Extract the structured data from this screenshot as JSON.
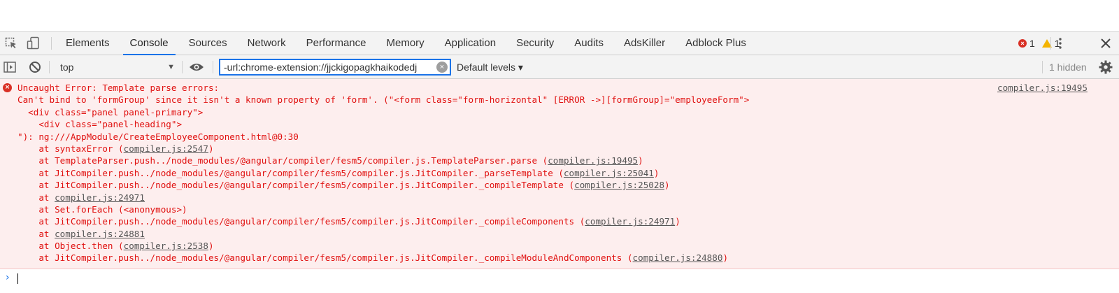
{
  "tabbar": {
    "tabs": [
      {
        "label": "Elements"
      },
      {
        "label": "Console"
      },
      {
        "label": "Sources"
      },
      {
        "label": "Network"
      },
      {
        "label": "Performance"
      },
      {
        "label": "Memory"
      },
      {
        "label": "Application"
      },
      {
        "label": "Security"
      },
      {
        "label": "Audits"
      },
      {
        "label": "AdsKiller"
      },
      {
        "label": "Adblock Plus"
      }
    ],
    "active_tab": "Console",
    "error_count": "1",
    "warning_count": "1"
  },
  "toolbar": {
    "context": "top",
    "filter_value": "-url:chrome-extension://jjckigopagkhaikodedj",
    "levels_label": "Default levels ▾",
    "hidden_label": "1 hidden"
  },
  "console": {
    "source_link": "compiler.js:19495",
    "lines": [
      {
        "text": "Uncaught Error: Template parse errors:"
      },
      {
        "text": "Can't bind to 'formGroup' since it isn't a known property of 'form'. (\"<form class=\"form-horizontal\" [ERROR ->][formGroup]=\"employeeForm\">"
      },
      {
        "text": "  <div class=\"panel panel-primary\">"
      },
      {
        "text": "    <div class=\"panel-heading\">"
      },
      {
        "text": "\"): ng:///AppModule/CreateEmployeeComponent.html@0:30"
      },
      {
        "text": "    at syntaxError (",
        "link": "compiler.js:2547",
        "suffix": ")"
      },
      {
        "text": "    at TemplateParser.push../node_modules/@angular/compiler/fesm5/compiler.js.TemplateParser.parse (",
        "link": "compiler.js:19495",
        "suffix": ")"
      },
      {
        "text": "    at JitCompiler.push../node_modules/@angular/compiler/fesm5/compiler.js.JitCompiler._parseTemplate (",
        "link": "compiler.js:25041",
        "suffix": ")"
      },
      {
        "text": "    at JitCompiler.push../node_modules/@angular/compiler/fesm5/compiler.js.JitCompiler._compileTemplate (",
        "link": "compiler.js:25028",
        "suffix": ")"
      },
      {
        "text": "    at ",
        "link": "compiler.js:24971",
        "suffix": ""
      },
      {
        "text": "    at Set.forEach (<anonymous>)"
      },
      {
        "text": "    at JitCompiler.push../node_modules/@angular/compiler/fesm5/compiler.js.JitCompiler._compileComponents (",
        "link": "compiler.js:24971",
        "suffix": ")"
      },
      {
        "text": "    at ",
        "link": "compiler.js:24881",
        "suffix": ""
      },
      {
        "text": "    at Object.then (",
        "link": "compiler.js:2538",
        "suffix": ")"
      },
      {
        "text": "    at JitCompiler.push../node_modules/@angular/compiler/fesm5/compiler.js.JitCompiler._compileModuleAndComponents (",
        "link": "compiler.js:24880",
        "suffix": ")"
      }
    ]
  },
  "prompt_symbol": "›",
  "colors": {
    "error_text": "#e0100f",
    "error_bg": "#fdeeee",
    "accent": "#1a73e8",
    "warning": "#f4b400"
  },
  "icons": [
    "inspect-icon",
    "device-toggle-icon",
    "kebab-menu-icon",
    "close-icon",
    "sidebar-toggle-icon",
    "clear-console-icon",
    "live-expression-icon",
    "settings-icon"
  ]
}
